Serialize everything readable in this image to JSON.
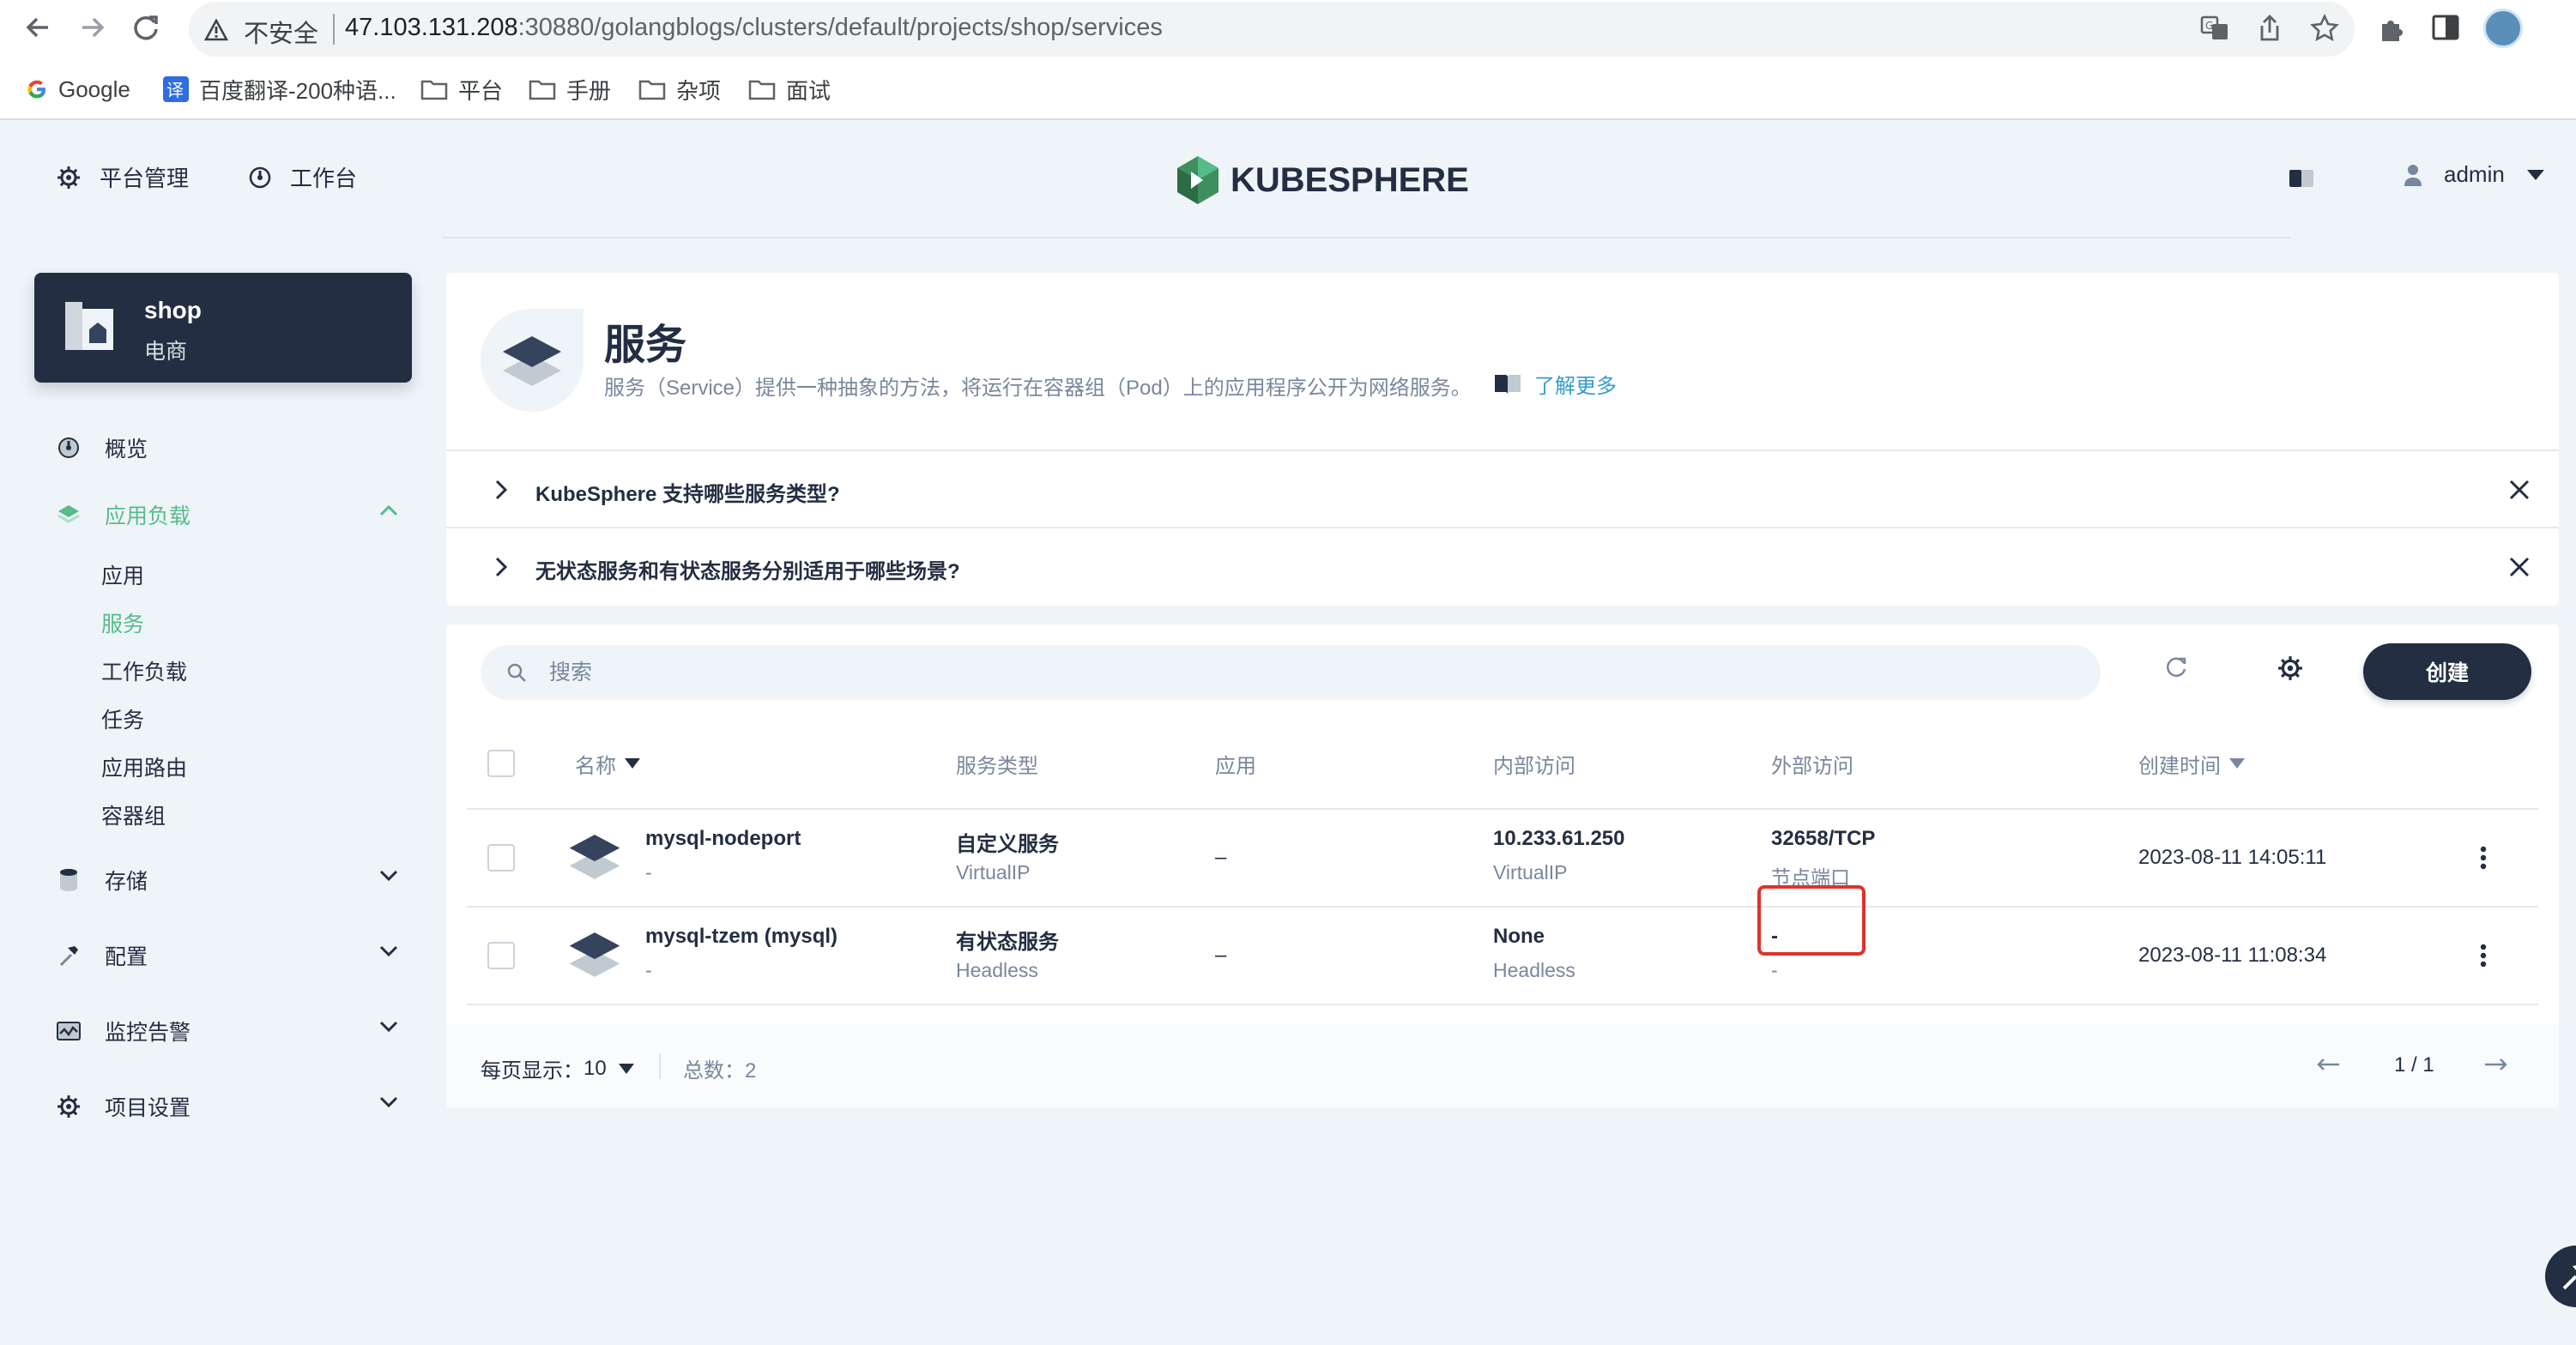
{
  "browser": {
    "not_secure": "不安全",
    "url_host": "47.103.131.208",
    "url_rest": ":30880/golangblogs/clusters/default/projects/shop/services",
    "bookmarks": [
      {
        "label": "Google",
        "icon": "google-icon"
      },
      {
        "label": "百度翻译-200种语...",
        "icon": "translate-icon"
      },
      {
        "label": "平台",
        "icon": "folder-icon"
      },
      {
        "label": "手册",
        "icon": "folder-icon"
      },
      {
        "label": "杂项",
        "icon": "folder-icon"
      },
      {
        "label": "面试",
        "icon": "folder-icon"
      }
    ]
  },
  "header": {
    "platform_label": "平台管理",
    "workbench_label": "工作台",
    "logo_text": "KUBESPHERE",
    "user": "admin"
  },
  "project": {
    "name": "shop",
    "alias": "电商"
  },
  "sidebar": {
    "overview": "概览",
    "workloads_group": "应用负载",
    "sub_items": [
      "应用",
      "服务",
      "工作负载",
      "任务",
      "应用路由",
      "容器组"
    ],
    "storage": "存储",
    "config": "配置",
    "monitoring": "监控告警",
    "project_settings": "项目设置"
  },
  "page": {
    "title": "服务",
    "description": "服务（Service）提供一种抽象的方法，将运行在容器组（Pod）上的应用程序公开为网络服务。",
    "learn_more": "了解更多",
    "faq": [
      "KubeSphere 支持哪些服务类型?",
      "无状态服务和有状态服务分别适用于哪些场景?"
    ]
  },
  "toolbar": {
    "search_placeholder": "搜索",
    "create_label": "创建"
  },
  "table": {
    "columns": [
      "名称",
      "服务类型",
      "应用",
      "内部访问",
      "外部访问",
      "创建时间"
    ],
    "rows": [
      {
        "name": "mysql-nodeport",
        "name_sub": "-",
        "type": "自定义服务",
        "type_sub": "VirtualIP",
        "app": "–",
        "internal": "10.233.61.250",
        "internal_sub": "VirtualIP",
        "external": "32658/TCP",
        "external_sub": "节点端口",
        "created": "2023-08-11 14:05:11"
      },
      {
        "name": "mysql-tzem (mysql)",
        "name_sub": "-",
        "type": "有状态服务",
        "type_sub": "Headless",
        "app": "–",
        "internal": "None",
        "internal_sub": "Headless",
        "external": "-",
        "external_sub": "-",
        "created": "2023-08-11 11:08:34"
      }
    ]
  },
  "pagination": {
    "per_page_label": "每页显示：",
    "per_page_value": "10",
    "total_label": "总数：",
    "total_value": "2",
    "page_info": "1 / 1"
  },
  "colors": {
    "accent_green": "#55bc8a",
    "dark": "#242e42",
    "link_blue": "#329dce",
    "highlight_red": "#e0322d"
  }
}
